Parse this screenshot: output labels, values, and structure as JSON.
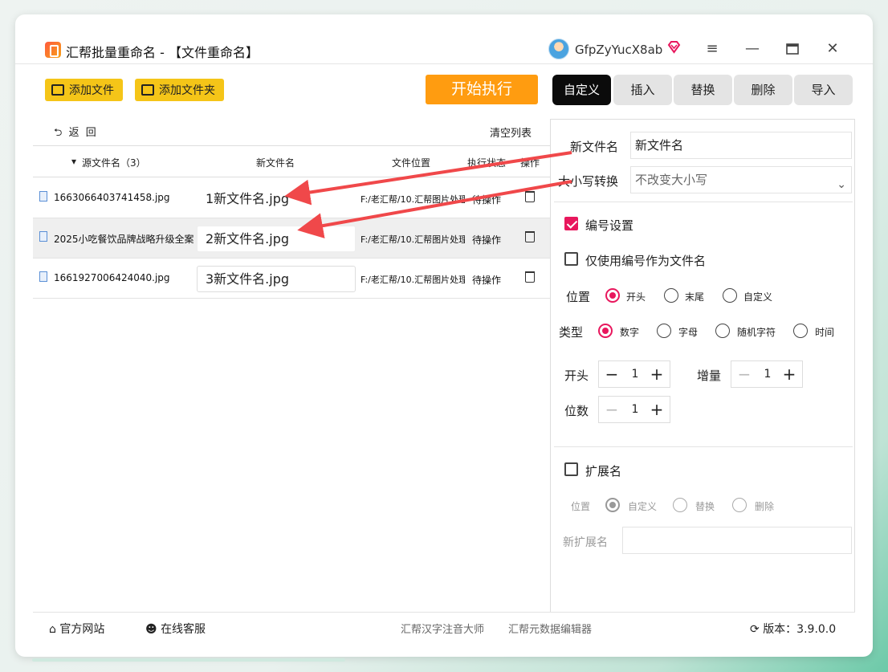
{
  "title": {
    "app_name": "汇帮批量重命名 - 【文件重命名】",
    "username": "GfpZyYucX8ab"
  },
  "toolbar": {
    "add_file": "添加文件",
    "add_folder": "添加文件夹",
    "start": "开始执行"
  },
  "tabs": [
    "自定义",
    "插入",
    "替换",
    "删除",
    "导入"
  ],
  "list": {
    "back": "返 回",
    "clear": "清空列表",
    "headers": {
      "source": "源文件名（3）",
      "new_name": "新文件名",
      "location": "文件位置",
      "status": "执行状态",
      "action": "操作"
    },
    "rows": [
      {
        "source": "1663066403741458.jpg",
        "new_name": "1新文件名.jpg",
        "location": "F:/老汇帮/10.汇帮图片处理器",
        "status": "待操作"
      },
      {
        "source": "2025小吃餐饮品牌战略升级全案",
        "new_name": "2新文件名.jpg",
        "location": "F:/老汇帮/10.汇帮图片处理器",
        "status": "待操作"
      },
      {
        "source": "1661927006424040.jpg",
        "new_name": "3新文件名.jpg",
        "location": "F:/老汇帮/10.汇帮图片处理器",
        "status": "待操作"
      }
    ]
  },
  "panel": {
    "new_name_label": "新文件名",
    "new_name_value": "新文件名",
    "case_label": "大小写转换",
    "case_value": "不改变大小写",
    "numbering": "编号设置",
    "numbering_checked": true,
    "only_number": "仅使用编号作为文件名",
    "only_number_checked": false,
    "position_label": "位置",
    "position_options": [
      "开头",
      "末尾",
      "自定义"
    ],
    "position_selected": "开头",
    "type_label": "类型",
    "type_options": [
      "数字",
      "字母",
      "随机字符",
      "时间"
    ],
    "type_selected": "数字",
    "start_label": "开头",
    "start_value": "1",
    "increment_label": "增量",
    "increment_value": "1",
    "digits_label": "位数",
    "digits_value": "1",
    "extension": "扩展名",
    "extension_checked": false,
    "ext_position_label": "位置",
    "ext_options": [
      "自定义",
      "替换",
      "删除"
    ],
    "ext_selected": "自定义",
    "new_ext_label": "新扩展名",
    "new_ext_value": ""
  },
  "footer": {
    "website": "官方网站",
    "support": "在线客服",
    "link1": "汇帮汉字注音大师",
    "link2": "汇帮元数据编辑器",
    "version": "版本：3.9.0.0"
  },
  "colors": {
    "accent": "#e8175d",
    "start_button": "#ff9c10",
    "toolbar_buttons": "#f5c518",
    "annotation_arrow": "#f0484a"
  }
}
